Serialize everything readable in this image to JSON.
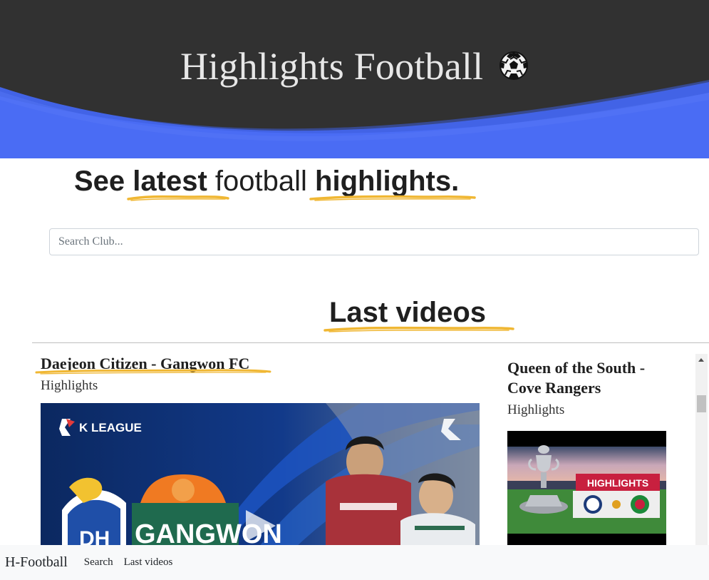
{
  "header": {
    "title": "Highlights Football",
    "title_icon": "soccer-ball-icon",
    "bg_color": "#313131",
    "wave_color": "#4a6cf4"
  },
  "tagline": {
    "part1": "See ",
    "part2": "latest",
    "part3": " football ",
    "part4": "highlights",
    "part5": "."
  },
  "search": {
    "placeholder": "Search Club...",
    "value": ""
  },
  "section": {
    "title": "Last videos"
  },
  "videos": [
    {
      "title": "Daejeon Citizen - Gangwon FC",
      "subtitle": "Highlights",
      "thumb_label": "K LEAGUE",
      "thumb_team": "GANGWON"
    },
    {
      "title": "Queen of the South - Cove Rangers",
      "subtitle": "Highlights",
      "thumb_label": "HIGHLIGHTS"
    }
  ],
  "nav": {
    "brand": "H-Football",
    "links": [
      "Search",
      "Last videos"
    ]
  },
  "colors": {
    "accent_underline": "#f0b733"
  }
}
